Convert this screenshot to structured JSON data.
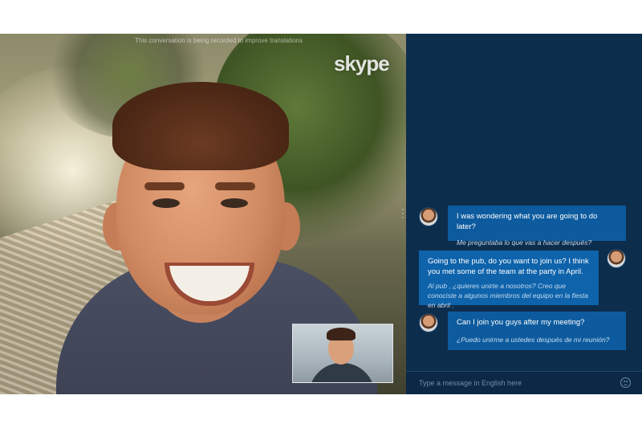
{
  "app": {
    "logo_text": "skype",
    "top_caption": "This conversation is being recorded to improve translations"
  },
  "colors": {
    "chat_background": "#0d2d4d",
    "bubble": "#0d5b9e",
    "translation_text": "#c7dcf0",
    "placeholder_text": "#6f8fad"
  },
  "messages": [
    {
      "sender": "remote",
      "text": "I was wondering what you are going to do later?",
      "translation": "Me preguntaba lo que vas a hacer después?"
    },
    {
      "sender": "self",
      "text": "Going to the pub, do you want to join us? I think you met some of the team at the party in April.",
      "translation": "Al pub , ¿quieres unirte a nosotros? Creo que conociste a algunos miembros del equipo en la fiesta en abril ."
    },
    {
      "sender": "remote",
      "text": "Can I join you guys after my meeting?",
      "translation": "¿Puedo unirme a ustedes después de mi reunión?"
    }
  ],
  "composer": {
    "placeholder": "Type a message in English here",
    "emoji_icon": "smiley-icon"
  }
}
